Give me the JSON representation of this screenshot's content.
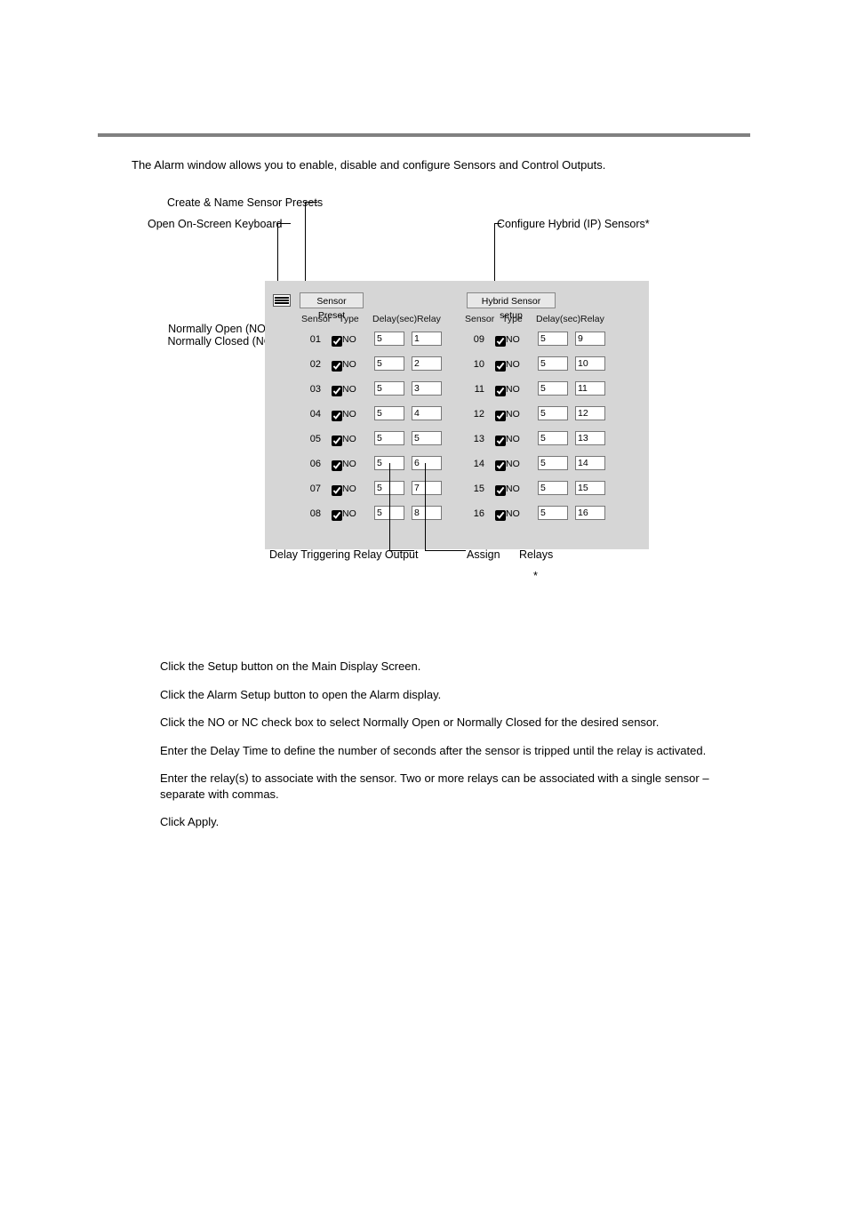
{
  "intro": "The Alarm window allows you to enable, disable and configure Sensors and Control Outputs.",
  "callouts": {
    "create_preset": "Create & Name Sensor Presets",
    "open_keyboard": "Open On-Screen Keyboard",
    "configure_hybrid": "Configure Hybrid (IP) Sensors*",
    "nonc_line1": "Normally Open (NO) /",
    "nonc_line2": "Normally Closed (NC)",
    "delay_trigger": "Delay Triggering Relay Output",
    "assign": "Assign",
    "relays": "Relays",
    "asterisk": "*"
  },
  "panel": {
    "sensor_preset_btn": "Sensor Preset",
    "hybrid_btn": "Hybrid Sensor setup",
    "headers": {
      "sensor": "Sensor",
      "type": "Type",
      "delay": "Delay(sec)",
      "relay": "Relay"
    },
    "left": [
      {
        "n": "01",
        "chk": true,
        "type": "NO",
        "delay": "5",
        "relay": "1"
      },
      {
        "n": "02",
        "chk": true,
        "type": "NO",
        "delay": "5",
        "relay": "2"
      },
      {
        "n": "03",
        "chk": true,
        "type": "NO",
        "delay": "5",
        "relay": "3"
      },
      {
        "n": "04",
        "chk": true,
        "type": "NO",
        "delay": "5",
        "relay": "4"
      },
      {
        "n": "05",
        "chk": true,
        "type": "NO",
        "delay": "5",
        "relay": "5"
      },
      {
        "n": "06",
        "chk": true,
        "type": "NO",
        "delay": "5",
        "relay": "6"
      },
      {
        "n": "07",
        "chk": true,
        "type": "NO",
        "delay": "5",
        "relay": "7"
      },
      {
        "n": "08",
        "chk": true,
        "type": "NO",
        "delay": "5",
        "relay": "8"
      }
    ],
    "right": [
      {
        "n": "09",
        "chk": true,
        "type": "NO",
        "delay": "5",
        "relay": "9"
      },
      {
        "n": "10",
        "chk": true,
        "type": "NO",
        "delay": "5",
        "relay": "10"
      },
      {
        "n": "11",
        "chk": true,
        "type": "NO",
        "delay": "5",
        "relay": "11"
      },
      {
        "n": "12",
        "chk": true,
        "type": "NO",
        "delay": "5",
        "relay": "12"
      },
      {
        "n": "13",
        "chk": true,
        "type": "NO",
        "delay": "5",
        "relay": "13"
      },
      {
        "n": "14",
        "chk": true,
        "type": "NO",
        "delay": "5",
        "relay": "14"
      },
      {
        "n": "15",
        "chk": true,
        "type": "NO",
        "delay": "5",
        "relay": "15"
      },
      {
        "n": "16",
        "chk": true,
        "type": "NO",
        "delay": "5",
        "relay": "16"
      }
    ]
  },
  "instructions": [
    "Click the Setup button on the Main Display Screen.",
    "Click the Alarm Setup button to open the Alarm display.",
    "Click the NO or NC check box to select Normally Open or Normally Closed for the desired sensor.",
    "Enter the Delay Time to define the number of seconds after the sensor is tripped until the relay is activated.",
    "Enter the relay(s) to associate with the sensor.  Two or more relays can be associated with a single sensor – separate with commas.",
    "Click Apply."
  ]
}
